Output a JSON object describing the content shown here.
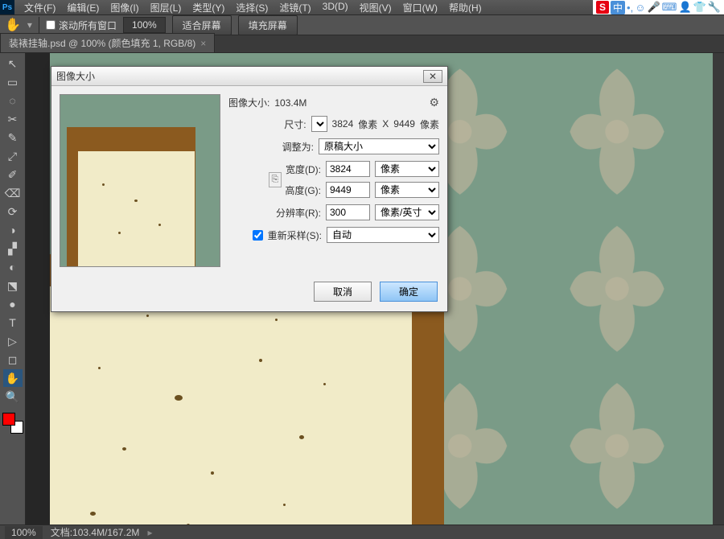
{
  "menu": [
    "文件(F)",
    "编辑(E)",
    "图像(I)",
    "图层(L)",
    "类型(Y)",
    "选择(S)",
    "滤镜(T)",
    "3D(D)",
    "视图(V)",
    "窗口(W)",
    "帮助(H)"
  ],
  "ime": {
    "cn": "中"
  },
  "options": {
    "scroll_all": "滚动所有窗口",
    "zoom": "100%",
    "fit_screen": "适合屏幕",
    "fill_screen": "填充屏幕"
  },
  "tab": {
    "title": "装裱挂轴.psd @ 100% (颜色填充 1, RGB/8)",
    "close": "×"
  },
  "status": {
    "zoom": "100%",
    "doc": "文档:103.4M/167.2M"
  },
  "dialog": {
    "title": "图像大小",
    "close": "✕",
    "img_size_lbl": "图像大小:",
    "img_size_val": "103.4M",
    "dim_lbl": "尺寸:",
    "dim_val_w": "3824",
    "dim_val_h": "9449",
    "dim_unit": "像素",
    "dim_x": "X",
    "fit_lbl": "调整为:",
    "fit_val": "原稿大小",
    "w_lbl": "宽度(D):",
    "w_val": "3824",
    "h_lbl": "高度(G):",
    "h_val": "9449",
    "px_unit": "像素",
    "res_lbl": "分辨率(R):",
    "res_val": "300",
    "res_unit": "像素/英寸",
    "resample_lbl": "重新采样(S):",
    "resample_val": "自动",
    "cancel": "取消",
    "ok": "确定"
  },
  "tools": [
    "↖",
    "▭",
    "◌",
    "✂",
    "✎",
    "⤢",
    "✐",
    "⌫",
    "⟳",
    "◑",
    "▞",
    "◐",
    "⬔",
    "●",
    "▯",
    "✒",
    "T",
    "▷",
    "◻",
    "✋",
    "🔍"
  ]
}
